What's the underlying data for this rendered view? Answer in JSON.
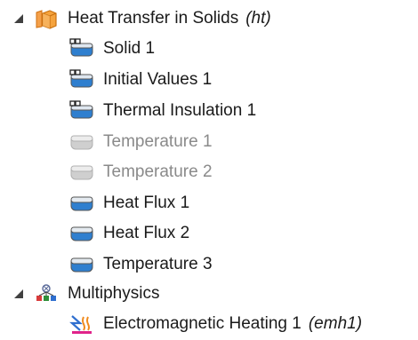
{
  "tree": {
    "physics": {
      "label": "Heat Transfer in Solids",
      "tag": "(ht)",
      "icon": "heat-transfer-physics-icon",
      "expanded": true,
      "children": [
        {
          "label": "Solid 1",
          "icon": "domain-node-default-icon",
          "state": "default"
        },
        {
          "label": "Initial Values 1",
          "icon": "domain-node-default-icon",
          "state": "default"
        },
        {
          "label": "Thermal Insulation 1",
          "icon": "boundary-node-default-icon",
          "state": "default"
        },
        {
          "label": "Temperature 1",
          "icon": "boundary-node-disabled-icon",
          "state": "disabled"
        },
        {
          "label": "Temperature 2",
          "icon": "boundary-node-disabled-icon",
          "state": "disabled"
        },
        {
          "label": "Heat Flux 1",
          "icon": "boundary-node-icon",
          "state": "active"
        },
        {
          "label": "Heat Flux 2",
          "icon": "boundary-node-icon",
          "state": "active"
        },
        {
          "label": "Temperature 3",
          "icon": "boundary-node-icon",
          "state": "active"
        }
      ]
    },
    "multiphysics": {
      "label": "Multiphysics",
      "icon": "multiphysics-icon",
      "expanded": true,
      "children": [
        {
          "label": "Electromagnetic Heating 1",
          "tag": "(emh1)",
          "icon": "electromagnetic-heating-icon"
        }
      ]
    }
  },
  "colors": {
    "node_blue": "#2f7fcf",
    "node_grey": "#c8c8c8",
    "text": "#1a1a1a",
    "text_disabled": "#8a8a8a",
    "physics_orange": "#f08a1c"
  }
}
